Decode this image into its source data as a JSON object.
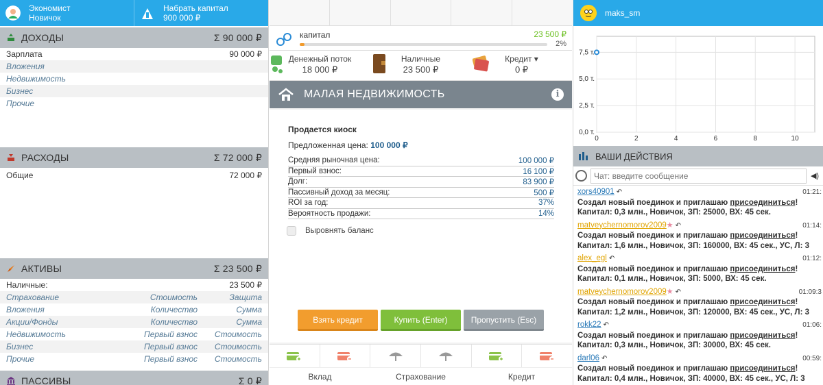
{
  "left": {
    "top": {
      "profile": {
        "line1": "Экономист",
        "line2": "Новичок"
      },
      "goal": {
        "line1": "Набрать капитал",
        "line2": "900 000 ₽"
      }
    },
    "income": {
      "title": "ДОХОДЫ",
      "sum": "Σ 90 000 ₽",
      "rows": [
        {
          "label": "Зарплата",
          "value": "90 000 ₽"
        },
        {
          "label": "Вложения"
        },
        {
          "label": "Недвижимость"
        },
        {
          "label": "Бизнес"
        },
        {
          "label": "Прочие"
        }
      ]
    },
    "expenses": {
      "title": "РАСХОДЫ",
      "sum": "Σ 72 000 ₽",
      "rows": [
        {
          "label": "Общие",
          "value": "72 000 ₽"
        }
      ]
    },
    "assets": {
      "title": "АКТИВЫ",
      "sum": "Σ 23 500 ₽",
      "cash": {
        "label": "Наличные:",
        "value": "23 500 ₽"
      },
      "rows": [
        {
          "c1": "Страхование",
          "c2": "Стоимость",
          "c3": "Защита"
        },
        {
          "c1": "Вложения",
          "c2": "Количество",
          "c3": "Сумма"
        },
        {
          "c1": "Акции/Фонды",
          "c2": "Количество",
          "c3": "Сумма"
        },
        {
          "c1": "Недвижимость",
          "c2": "Первый взнос",
          "c3": "Стоимость"
        },
        {
          "c1": "Бизнес",
          "c2": "Первый взнос",
          "c3": "Стоимость"
        },
        {
          "c1": "Прочие",
          "c2": "Первый взнос",
          "c3": "Стоимость"
        }
      ]
    },
    "liabilities": {
      "title": "ПАССИВЫ",
      "sum": "Σ 0 ₽"
    }
  },
  "center": {
    "capital": {
      "label": "капитал",
      "value": "23 500 ₽",
      "percent_text": "2%",
      "progress": 0.02
    },
    "money": {
      "cashflow": {
        "label": "Денежный поток",
        "value": "18 000 ₽"
      },
      "cash": {
        "label": "Наличные",
        "value": "23 500 ₽"
      },
      "credit": {
        "label": "Кредит ▾",
        "value": "0 ₽"
      }
    },
    "card": {
      "title": "МАЛАЯ НЕДВИЖИМОСТЬ",
      "deal_title": "Продается киоск",
      "offer_label": "Предложенная цена:",
      "offer_value": "100 000 ₽",
      "rows": [
        {
          "label": "Средняя рыночная цена:",
          "value": "100 000 ₽"
        },
        {
          "label": "Первый взнос:",
          "value": "16 100 ₽"
        },
        {
          "label": "Долг:",
          "value": "83 900 ₽"
        },
        {
          "label": "Пассивный доход за месяц:",
          "value": "500 ₽"
        },
        {
          "label": "ROI за год:",
          "value": "37%"
        },
        {
          "label": "Вероятность продажи:",
          "value": "14%"
        }
      ],
      "balance_label": "Выровнять баланс",
      "btn_credit": "Взять кредит",
      "btn_buy": "Купить (Enter)",
      "btn_skip": "Пропустить (Esc)"
    },
    "bottom": {
      "deposit": "Вклад",
      "insurance": "Страхование",
      "credit": "Кредит"
    }
  },
  "right": {
    "user": "maks_sm",
    "chart_data": {
      "type": "line",
      "title": "",
      "xlabel": "",
      "ylabel": "",
      "x_ticks": [
        "0",
        "2",
        "4",
        "6",
        "8",
        "10"
      ],
      "y_ticks": [
        "0,0 т.",
        "2,5 т.",
        "5,0 т.",
        "7,5 т."
      ],
      "xlim": [
        0,
        11
      ],
      "ylim": [
        0,
        9
      ],
      "grid": true,
      "series": [
        {
          "x": [
            0
          ],
          "y": [
            7.5
          ]
        }
      ]
    },
    "actions_title": "ВАШИ ДЕЙСТВИЯ",
    "chat_placeholder": "Чат: введите сообщение",
    "messages": [
      {
        "user": "xors40901",
        "gold": false,
        "time": "01:21:",
        "line1a": "Создал новый поединок и приглашаю ",
        "line1b": "присоединиться",
        "line1c": "!",
        "line2": "Капитал: 0,3 млн., Новичок, ЗП: 25000, ВХ: 45 сек."
      },
      {
        "user": "matveychernomorov2009",
        "gold": true,
        "time": "01:14:",
        "line1a": "Создал новый поединок и приглашаю ",
        "line1b": "присоединиться",
        "line1c": "!",
        "line2": "Капитал: 1,6 млн., Новичок, ЗП: 160000, ВХ: 45 сек., УС, Л: 3"
      },
      {
        "user": "alex_egl",
        "gold": true,
        "time": "01:12:",
        "line1a": "Создал новый поединок и приглашаю ",
        "line1b": "присоединиться",
        "line1c": "!",
        "line2": "Капитал: 0,1 млн., Новичок, ЗП: 5000, ВХ: 45 сек."
      },
      {
        "user": "matveychernomorov2009",
        "gold": true,
        "time": "01:09:3",
        "line1a": "Создал новый поединок и приглашаю ",
        "line1b": "присоединиться",
        "line1c": "!",
        "line2": "Капитал: 1,2 млн., Новичок, ЗП: 120000, ВХ: 45 сек., УС, Л: 3"
      },
      {
        "user": "rokk22",
        "gold": false,
        "time": "01:06:",
        "line1a": "Создал новый поединок и приглашаю ",
        "line1b": "присоединиться",
        "line1c": "!",
        "line2": "Капитал: 0,3 млн., Новичок, ЗП: 30000, ВХ: 45 сек."
      },
      {
        "user": "darl06",
        "gold": false,
        "time": "00:59:",
        "line1a": "Создал новый поединок и приглашаю ",
        "line1b": "присоединиться",
        "line1c": "!",
        "line2": "Капитал: 0,4 млн., Новичок, ЗП: 40000, ВХ: 45 сек., УС, Л: 3"
      }
    ]
  }
}
